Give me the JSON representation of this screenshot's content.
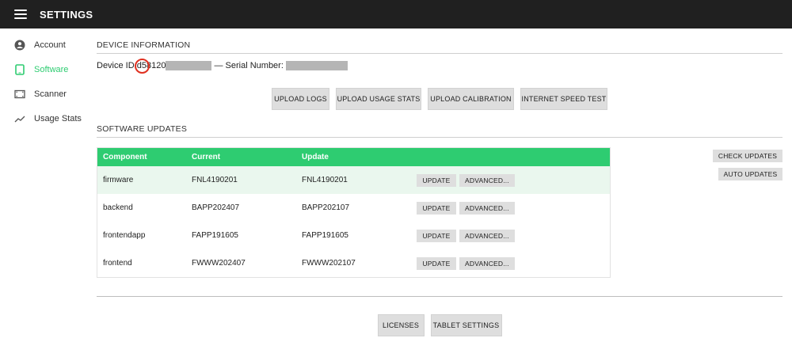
{
  "header": {
    "title": "SETTINGS"
  },
  "sidebar": {
    "items": [
      {
        "label": "Account",
        "icon": "account-icon",
        "active": false
      },
      {
        "label": "Software",
        "icon": "tablet-icon",
        "active": true
      },
      {
        "label": "Scanner",
        "icon": "scanner-icon",
        "active": false
      },
      {
        "label": "Usage Stats",
        "icon": "trend-icon",
        "active": false
      }
    ]
  },
  "device_info": {
    "section_title": "DEVICE INFORMATION",
    "device_id_label": "Device ID:",
    "device_id_visible_prefix": "d5",
    "device_id_visible_middle": "8120",
    "serial_label": "— Serial Number:",
    "buttons": [
      "UPLOAD LOGS",
      "UPLOAD USAGE STATS",
      "UPLOAD CALIBRATION",
      "INTERNET SPEED TEST"
    ]
  },
  "software_updates": {
    "section_title": "SOFTWARE UPDATES",
    "columns": [
      "Component",
      "Current",
      "Update"
    ],
    "rows": [
      {
        "component": "firmware",
        "current": "FNL4190201",
        "update": "FNL4190201"
      },
      {
        "component": "backend",
        "current": "BAPP202407",
        "update": "BAPP202107"
      },
      {
        "component": "frontendapp",
        "current": "FAPP191605",
        "update": "FAPP191605"
      },
      {
        "component": "frontend",
        "current": "FWWW202407",
        "update": "FWWW202107"
      }
    ],
    "row_buttons": {
      "update": "UPDATE",
      "advanced": "ADVANCED..."
    },
    "check_updates": "CHECK UPDATES",
    "auto_updates": "AUTO UPDATES"
  },
  "footer": {
    "buttons": [
      "LICENSES",
      "TABLET SETTINGS"
    ]
  },
  "colors": {
    "accent": "#2ecc71",
    "topbar": "#202020",
    "highlight_circle": "#e03020"
  }
}
